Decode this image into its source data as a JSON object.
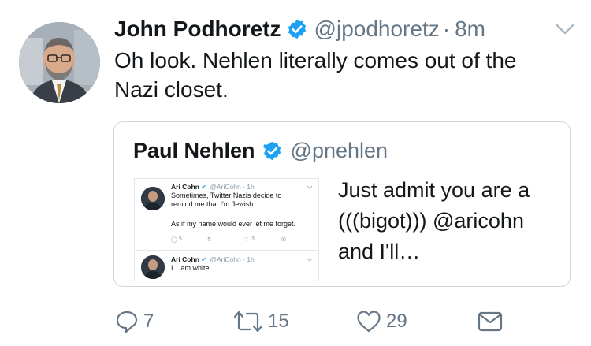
{
  "tweet": {
    "author_name": "John Podhoretz",
    "author_handle": "@jpodhoretz",
    "separator": "·",
    "time": "8m",
    "text": "Oh look. Nehlen literally comes out of the Nazi closet."
  },
  "quoted_tweet": {
    "author_name": "Paul Nehlen",
    "author_handle": "@pnehlen",
    "text": "Just admit you are a (((bigot))) @aricohn and I'll…",
    "screenshot": {
      "tweet1": {
        "name": "Ari Cohn",
        "handle": "@AriCohn · 1h",
        "line1": "Sometimes, Twitter Nazis decide to",
        "line2": "remind me that I'm Jewish.",
        "line3": "As if my name would ever let me forget.",
        "reply_count": "5",
        "like_count": "3"
      },
      "tweet2": {
        "name": "Ari Cohn",
        "handle": "@AriCohn · 1h",
        "line1": "I....am white."
      }
    }
  },
  "actions": {
    "reply_count": "7",
    "retweet_count": "15",
    "like_count": "29"
  },
  "colors": {
    "verified_blue": "#1da1f2",
    "secondary_text": "#657786",
    "border": "#ccd6dd"
  }
}
